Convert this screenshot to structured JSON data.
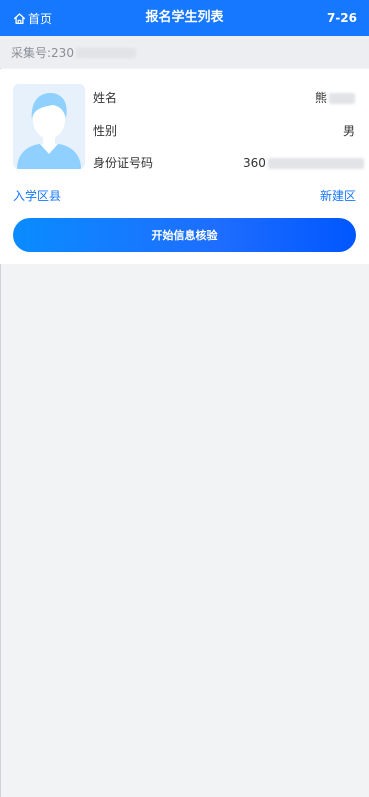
{
  "header": {
    "home_label": "首页",
    "title": "报名学生列表",
    "date": "7-26"
  },
  "collect": {
    "label": "采集号:",
    "value_visible": "230"
  },
  "student": {
    "avatar_icon": "student-avatar-icon",
    "name_label": "姓名",
    "name_value": "熊",
    "gender_label": "性别",
    "gender_value": "男",
    "id_label": "身份证号码",
    "id_value": "360",
    "district_label": "入学区县",
    "district_value": "新建区"
  },
  "actions": {
    "start_button": "开始信息核验"
  },
  "colors": {
    "brand": "#1677ff",
    "avatar_bg": "#e6f1fb",
    "avatar_figure": "#8fd0ff",
    "page_bg": "#f2f3f5"
  }
}
